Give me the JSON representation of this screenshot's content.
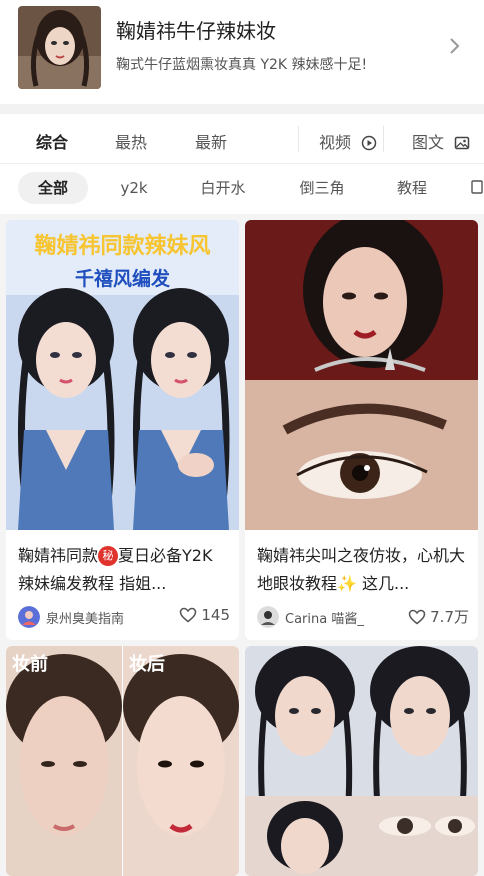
{
  "topic": {
    "title": "鞠婧祎牛仔辣妹妆",
    "description": "鞠式牛仔蓝烟熏妆真真 Y2K 辣妹感十足!"
  },
  "sort_tabs": [
    {
      "label": "综合",
      "active": true
    },
    {
      "label": "最热",
      "active": false
    },
    {
      "label": "最新",
      "active": false
    }
  ],
  "view_tabs": [
    {
      "label": "视频",
      "icon": "play-circle-icon"
    },
    {
      "label": "图文",
      "icon": "image-icon"
    }
  ],
  "chips": [
    {
      "label": "全部",
      "active": true
    },
    {
      "label": "y2k",
      "active": false
    },
    {
      "label": "白开水",
      "active": false
    },
    {
      "label": "倒三角",
      "active": false
    },
    {
      "label": "教程",
      "active": false
    }
  ],
  "cards": [
    {
      "title_before": "鞠婧祎同款",
      "badge": "秘",
      "title_after": "夏日必备Y2K 辣妹编发教程 指姐...",
      "image_overlay_line1": "鞠婧祎同款辣妹风",
      "image_overlay_line2": "千禧风编发",
      "author": "泉州臭美指南",
      "likes": "145",
      "avatar_color": "#5a6fd8"
    },
    {
      "title": "鞠婧祎尖叫之夜仿妆，心机大地眼妆教程✨ 这几...",
      "author": "Carina 喵酱_",
      "likes": "7.7万",
      "avatar_color": "#333333"
    },
    {
      "image_overlay_left": "妆前",
      "image_overlay_right": "妆后"
    },
    {}
  ],
  "colors": {
    "accent_red": "#e0332e",
    "banner_blue": "#1f4fbf",
    "banner_yellow": "#f7c531"
  }
}
